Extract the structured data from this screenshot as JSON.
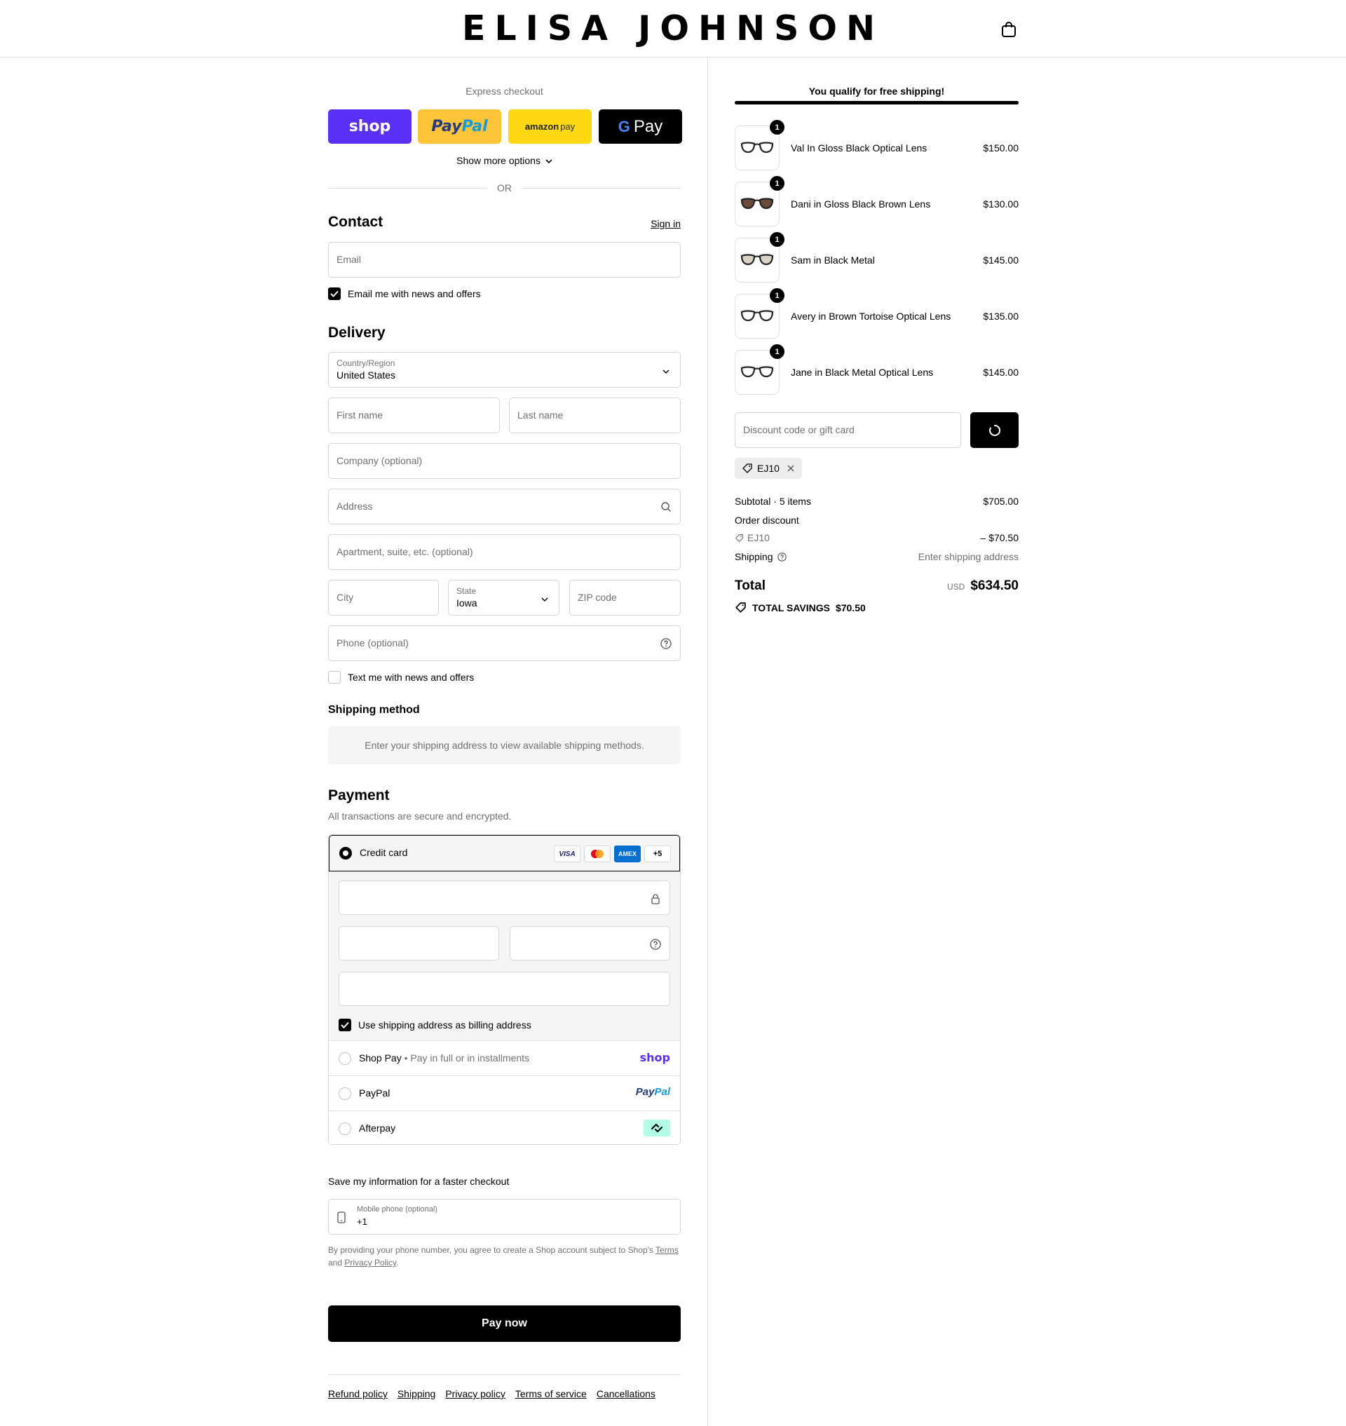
{
  "header": {
    "brand": "ELISA JOHNSON",
    "cart_icon": "shopping-bag-icon"
  },
  "express": {
    "label": "Express checkout",
    "shop_label": "shop",
    "paypal_a": "Pay",
    "paypal_b": "Pal",
    "amazon_a": "amazon",
    "amazon_b": "pay",
    "gpay_g": "G",
    "gpay_label": "Pay",
    "show_more": "Show more options",
    "or": "OR"
  },
  "contact": {
    "title": "Contact",
    "sign_in": "Sign in",
    "email_placeholder": "Email",
    "news_label": "Email me with news and offers",
    "news_checked": true
  },
  "delivery": {
    "title": "Delivery",
    "country_label": "Country/Region",
    "country_value": "United States",
    "first_name": "First name",
    "last_name": "Last name",
    "company": "Company (optional)",
    "address": "Address",
    "apartment": "Apartment, suite, etc. (optional)",
    "city": "City",
    "state_label": "State",
    "state_value": "Iowa",
    "zip": "ZIP code",
    "phone": "Phone (optional)",
    "text_label": "Text me with news and offers",
    "text_checked": false
  },
  "shipping_method": {
    "title": "Shipping method",
    "message": "Enter your shipping address to view available shipping methods."
  },
  "payment": {
    "title": "Payment",
    "subtitle": "All transactions are secure and encrypted.",
    "credit_card": "Credit card",
    "cards": [
      "VISA",
      "",
      "AMEX",
      "+5"
    ],
    "billing_label": "Use shipping address as billing address",
    "billing_checked": true,
    "shop_pay": "Shop Pay",
    "shop_pay_sub": "Pay in full or in installments",
    "shop_brand": "shop",
    "paypal": "PayPal",
    "paypal_brand_a": "Pay",
    "paypal_brand_b": "Pal",
    "afterpay": "Afterpay"
  },
  "save_info": {
    "title": "Save my information for a faster checkout",
    "mobile_label": "Mobile phone (optional)",
    "mobile_value": "+1",
    "disclaimer_a": "By providing your phone number, you agree to create a Shop account subject to Shop's",
    "terms": "Terms",
    "and": "and",
    "privacy": "Privacy Policy",
    "dot": "."
  },
  "pay_now": "Pay now",
  "footer": [
    "Refund policy",
    "Shipping",
    "Privacy policy",
    "Terms of service",
    "Cancellations"
  ],
  "summary": {
    "free_shipping": "You qualify for free shipping!",
    "items": [
      {
        "name": "Val In Gloss Black Optical Lens",
        "price": "$150.00",
        "qty": "1",
        "lens": "#ffffff"
      },
      {
        "name": "Dani in Gloss Black Brown Lens",
        "price": "$130.00",
        "qty": "1",
        "lens": "#6b4a3a"
      },
      {
        "name": "Sam in Black Metal",
        "price": "$145.00",
        "qty": "1",
        "lens": "#d9d2c5"
      },
      {
        "name": "Avery in Brown Tortoise Optical Lens",
        "price": "$135.00",
        "qty": "1",
        "lens": "#ffffff"
      },
      {
        "name": "Jane in Black Metal Optical Lens",
        "price": "$145.00",
        "qty": "1",
        "lens": "#ffffff"
      }
    ],
    "discount_placeholder": "Discount code or gift card",
    "applied_code": "EJ10",
    "subtotal_label": "Subtotal · 5 items",
    "subtotal": "$705.00",
    "order_discount": "Order discount",
    "discount_code": "EJ10",
    "discount_amount": "– $70.50",
    "shipping_label": "Shipping",
    "shipping_value": "Enter shipping address",
    "total_label": "Total",
    "currency": "USD",
    "total": "$634.50",
    "savings_label": "TOTAL SAVINGS",
    "savings": "$70.50"
  },
  "colors": {
    "shop": "#5a31f4",
    "paypal_yellow": "#ffc439",
    "amazon_yellow": "#ffd814",
    "afterpay": "#b2fce4"
  }
}
